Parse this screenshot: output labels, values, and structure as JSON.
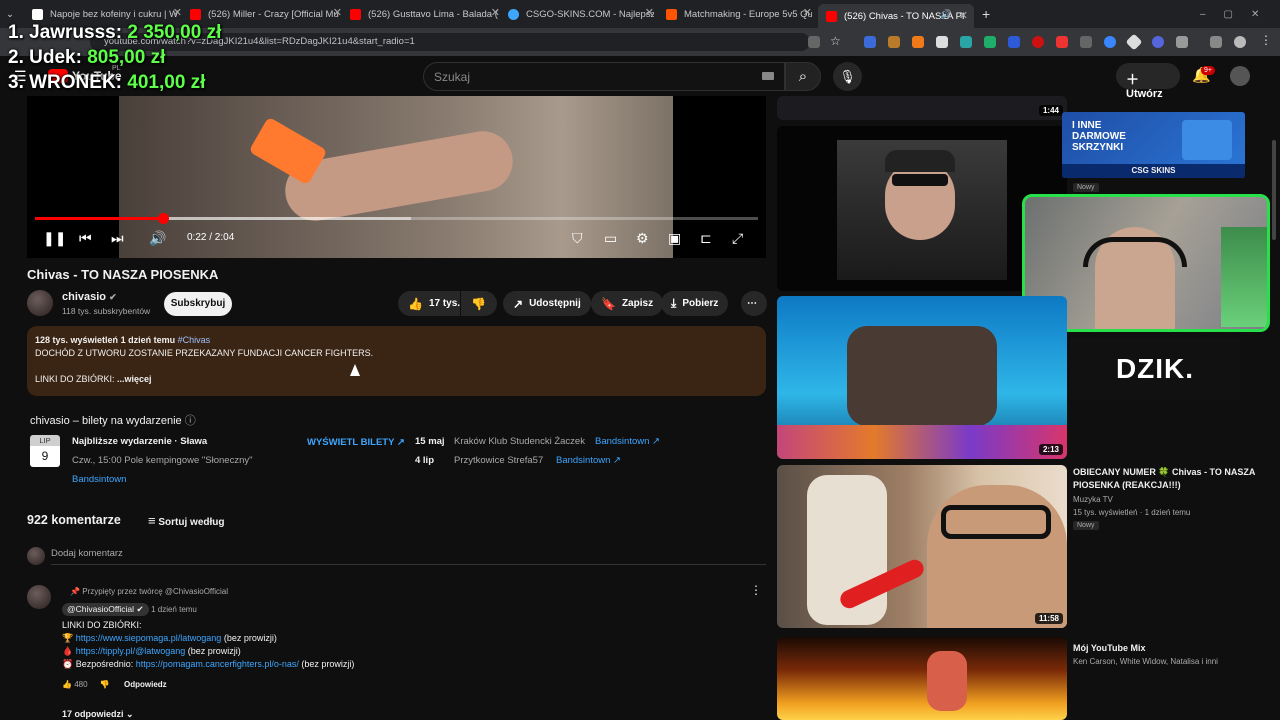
{
  "browser": {
    "tabs": [
      {
        "title": "Napoje bez kofeiny i cukru | W",
        "color": "#ffffff"
      },
      {
        "title": "(526) Miller - Crazy [Official Mu",
        "color": "#ff0000"
      },
      {
        "title": "(526) Gusttavo Lima - Balada (",
        "color": "#ff0000"
      },
      {
        "title": "CSGO-SKINS.COM - Najlepsze",
        "color": "#3ea6ff"
      },
      {
        "title": "Matchmaking - Europe 5v5 Qu",
        "color": "#ff5500"
      },
      {
        "title": "(526) Chivas - TO NASZA PI",
        "color": "#ff0000"
      }
    ],
    "url": "youtube.com/watch?v=zDagJKI21u4&list=RDzDagJKI21u4&start_radio=1"
  },
  "stream_overlay": {
    "leaders": [
      {
        "name": "1. Jawrusss:",
        "amount": "2 350,00 zł"
      },
      {
        "name": "2. Udek:",
        "amount": "805,00 zł"
      },
      {
        "name": "3. WRONEK:",
        "amount": "401,00 zł"
      }
    ]
  },
  "youtube": {
    "logo": "YouTube",
    "logo_region": "PL",
    "search_placeholder": "Szukaj",
    "create_label": "Utwórz",
    "notifications_badge": "9+"
  },
  "player": {
    "time": "0:22 / 2:04",
    "progress_fraction": 0.177,
    "buffered_fraction": 0.52
  },
  "video": {
    "title": "Chivas - TO NASZA PIOSENKA",
    "channel": "chivasio",
    "subscribers": "118 tys. subskrybentów",
    "subscribe_label": "Subskrybuj",
    "likes": "17 tys.",
    "share_label": "Udostępnij",
    "save_label": "Zapisz",
    "download_label": "Pobierz"
  },
  "description": {
    "views": "128 tys. wyświetleń",
    "date": "1 dzień temu",
    "hashtag": "#Chivas",
    "line1": "DOCHÓD Z UTWORU ZOSTANIE PRZEKAZANY FUNDACJI CANCER FIGHTERS.",
    "line2": "LINKI DO ZBIÓRKI:",
    "more": "...więcej"
  },
  "tickets": {
    "heading": "chivasio – bilety na wydarzenie",
    "cal_month": "LIP",
    "cal_day": "9",
    "next_event": "Najbliższe wydarzenie · Sława",
    "next_event_detail": "Czw., 15:00 Pole kempingowe \"Słoneczny\"",
    "provider": "Bandsintown",
    "view_tickets": "WYŚWIETL BILETY",
    "events": [
      {
        "date": "15 maj",
        "place": "Kraków Klub Studencki Żaczek",
        "provider": "Bandsintown"
      },
      {
        "date": "4 lip",
        "place": "Przytkowice Strefa57",
        "provider": "Bandsintown"
      }
    ]
  },
  "comments": {
    "count": "922 komentarze",
    "sort_label": "Sortuj według",
    "add_placeholder": "Dodaj komentarz",
    "pinned_label": "Przypięty przez twórcę @ChivasioOfficial",
    "author": "@ChivasioOfficial",
    "time": "1 dzień temu",
    "body_title": "LINKI DO ZBIÓRKI:",
    "links": [
      {
        "url": "https://www.siepomaga.pl/latwogang",
        "note": "(bez prowizji)"
      },
      {
        "url": "https://tipply.pl/@latwogang",
        "note": "(bez prowizji)"
      },
      {
        "prefix": "Bezpośrednio:",
        "url": "https://pomagam.cancerfighters.pl/o-nas/",
        "note": "(bez prowizji)"
      }
    ],
    "likes": "480",
    "reply_label": "Odpowiedz",
    "replies": "17 odpowiedzi"
  },
  "sidebar": {
    "top_duration": "1:44",
    "ad_text": [
      "I INNE",
      "DARMOWE",
      "SKRZYNKI"
    ],
    "ad_brand": "CSG SKINS",
    "ad_badge": "Nowy",
    "items": [
      {
        "duration": "2:13"
      },
      {
        "title": "OBIECANY NUMER 🍀 Chivas - TO NASZA PIOSENKA (REAKCJA!!!)",
        "channel": "Muzyka TV",
        "meta": "15 tys. wyświetleń · 1 dzień temu",
        "badge": "Nowy",
        "duration": "11:58"
      },
      {
        "title": "Mój YouTube Mix",
        "channel": "Ken Carson, White Widow, Natalisa i inni"
      }
    ],
    "dzik": "DZIK."
  }
}
